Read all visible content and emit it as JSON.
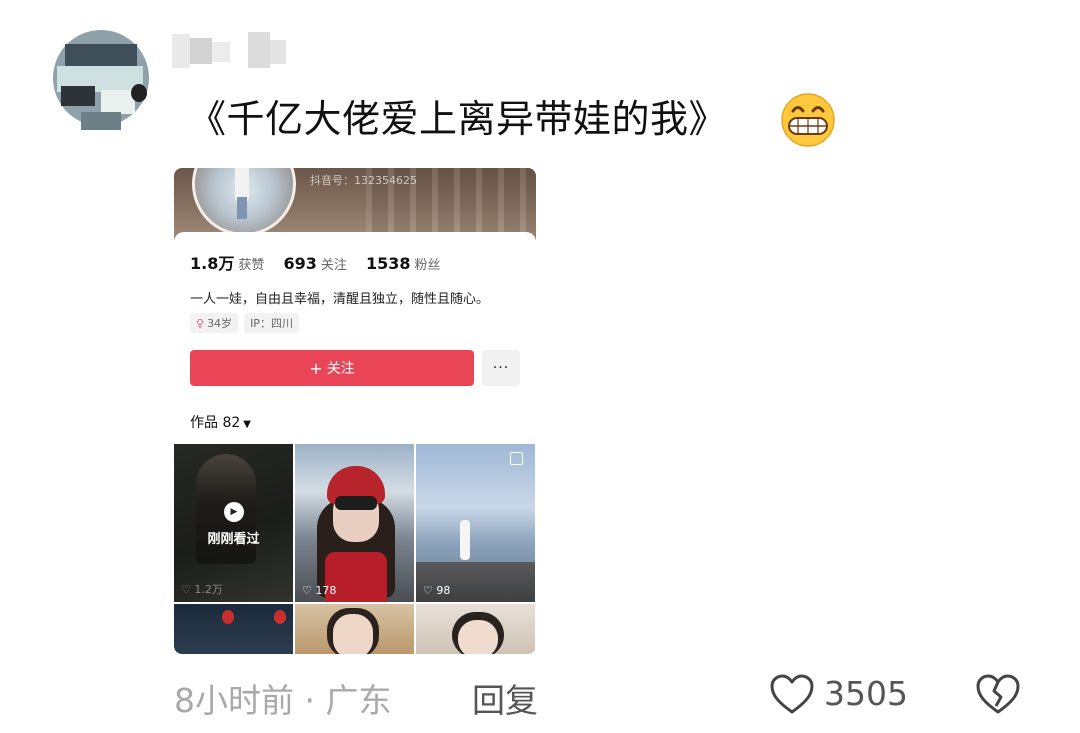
{
  "comment": {
    "text": "《千亿大佬爱上离异带娃的我》",
    "emoji": "grinning-face-emoji"
  },
  "embedded_profile": {
    "douyin_id": "抖音号：132354625",
    "stats": [
      {
        "value": "1.8万",
        "label": "获赞"
      },
      {
        "value": "693",
        "label": "关注"
      },
      {
        "value": "1538",
        "label": "粉丝"
      }
    ],
    "bio": "一人一娃，自由且幸福，清醒且独立，随性且随心。",
    "tags": [
      {
        "icon": "female-symbol-icon",
        "text": "34岁"
      },
      {
        "icon": "",
        "text": "IP：四川"
      }
    ],
    "follow_label": "关注",
    "more_label": "···",
    "works_label": "作品 82",
    "videos": [
      {
        "overlay": "刚刚看过",
        "likes": "1.2万"
      },
      {
        "overlay": "",
        "likes": "178"
      },
      {
        "overlay": "",
        "likes": "98"
      }
    ]
  },
  "meta": {
    "time_location": "8小时前 · 广东",
    "reply_label": "回复",
    "like_count": "3505"
  },
  "colors": {
    "follow_button": "#ea4556",
    "meta_text": "#a9a9a9"
  }
}
